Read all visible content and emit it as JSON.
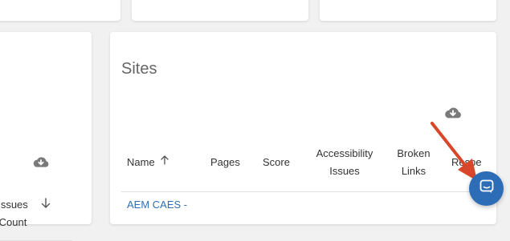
{
  "colors": {
    "page_bg": "#f1f1f1",
    "card_bg": "#ffffff",
    "link": "#2f6fb3",
    "chat_button": "#2d6cb6",
    "annotation_arrow": "#d9472b"
  },
  "left_panel": {
    "partial_text": "t",
    "column_header": "Issues Count",
    "column_header_line1": "Issues",
    "column_header_line2": "Count",
    "download_icon": "cloud-download-icon",
    "sort_icon": "arrow-down-icon"
  },
  "sites": {
    "title": "Sites",
    "download_icon": "cloud-download-icon",
    "columns": {
      "name": "Name",
      "pages": "Pages",
      "score": "Score",
      "accessibility_line1": "Accessibility",
      "accessibility_line2": "Issues",
      "broken_line1": "Broken",
      "broken_line2": "Links",
      "responsive_partial": "Respe"
    },
    "name_sort_icon": "arrow-up-icon",
    "rows": [
      {
        "name": "AEM CAES -"
      }
    ]
  },
  "chat": {
    "icon": "chat-bubble-icon"
  },
  "annotation": {
    "icon": "red-arrow-icon"
  }
}
